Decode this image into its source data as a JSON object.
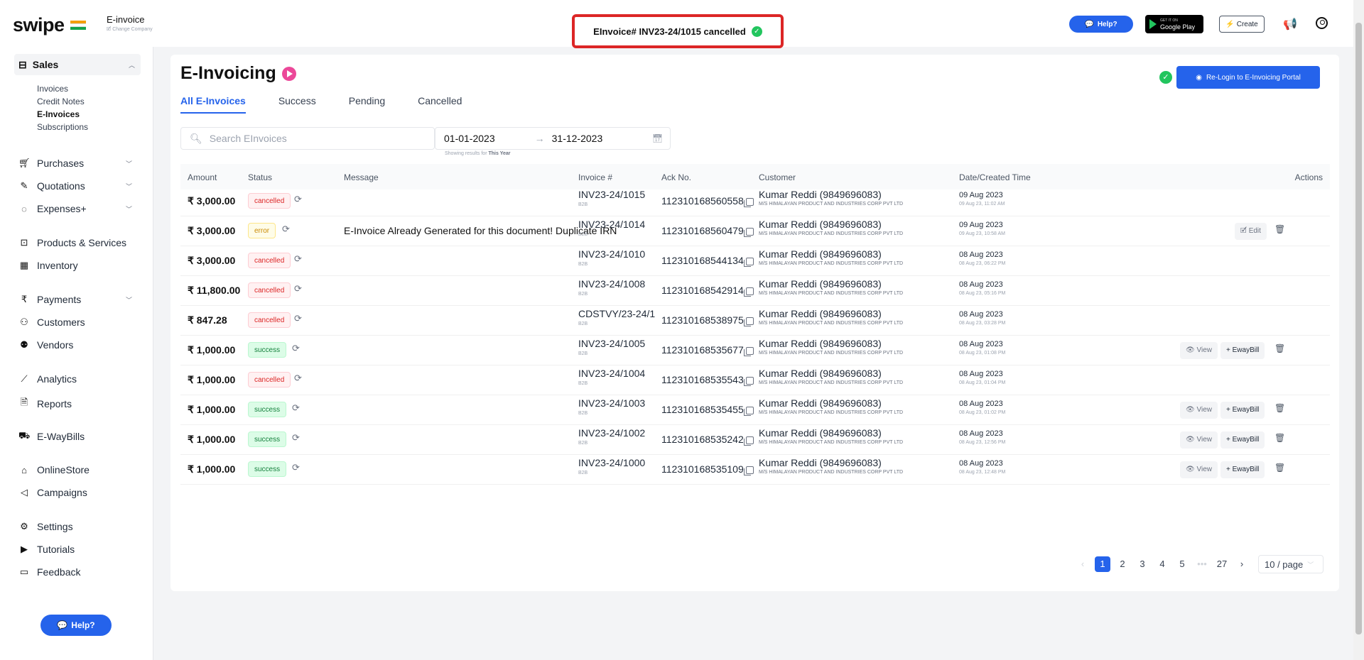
{
  "brand": {
    "name": "swipe"
  },
  "company": {
    "title": "E-invoice",
    "subtitle": "🗹 Change Company"
  },
  "toast": {
    "text": "EInvoice# INV23-24/1015 cancelled"
  },
  "header": {
    "help_label": "Help?",
    "play_small": "GET IT ON",
    "play_label": "Google Play",
    "create_label": "Create"
  },
  "sidebar": {
    "sales_label": "Sales",
    "sub_items": [
      "Invoices",
      "Credit Notes",
      "E-Invoices",
      "Subscriptions"
    ],
    "items": [
      "Purchases",
      "Quotations",
      "Expenses+",
      "Products & Services",
      "Inventory",
      "Payments",
      "Customers",
      "Vendors",
      "Analytics",
      "Reports",
      "E-WayBills",
      "OnlineStore",
      "Campaigns",
      "Settings",
      "Tutorials",
      "Feedback"
    ],
    "help_label": "Help?"
  },
  "page": {
    "title": "E-Invoicing",
    "relogin_label": "Re-Login to E-Invoicing Portal"
  },
  "tabs": [
    "All E-Invoices",
    "Success",
    "Pending",
    "Cancelled"
  ],
  "search": {
    "placeholder": "Search EInvoices"
  },
  "daterange": {
    "from": "01-01-2023",
    "to": "31-12-2023",
    "note_prefix": "Showing results for",
    "note_period": "This Year"
  },
  "table": {
    "headers": {
      "amount": "Amount",
      "status": "Status",
      "message": "Message",
      "invoice": "Invoice #",
      "ack": "Ack No.",
      "customer": "Customer",
      "date": "Date/Created Time",
      "actions": "Actions"
    },
    "rows": [
      {
        "amount": "₹ 3,000.00",
        "status": "cancelled",
        "message": "",
        "invoice": "INV23-24/1015",
        "inv_type": "B2B",
        "ack": "112310168560558",
        "customer": "Kumar Reddi (9849696083)",
        "company": "M/S HIMALAYAN PRODUCT AND INDUSTRIES CORP PVT LTD",
        "date": "09 Aug 2023",
        "time": "09 Aug 23, 11:02 AM",
        "actions": []
      },
      {
        "amount": "₹ 3,000.00",
        "status": "error",
        "message": "E-Invoice Already Generated for this document! Duplicate IRN",
        "invoice": "INV23-24/1014",
        "inv_type": "B2B",
        "ack": "112310168560479",
        "customer": "Kumar Reddi (9849696083)",
        "company": "M/S HIMALAYAN PRODUCT AND INDUSTRIES CORP PVT LTD",
        "date": "09 Aug 2023",
        "time": "09 Aug 23, 10:58 AM",
        "actions": [
          "edit"
        ]
      },
      {
        "amount": "₹ 3,000.00",
        "status": "cancelled",
        "message": "",
        "invoice": "INV23-24/1010",
        "inv_type": "B2B",
        "ack": "112310168544134",
        "customer": "Kumar Reddi (9849696083)",
        "company": "M/S HIMALAYAN PRODUCT AND INDUSTRIES CORP PVT LTD",
        "date": "08 Aug 2023",
        "time": "08 Aug 23, 06:22 PM",
        "actions": []
      },
      {
        "amount": "₹ 11,800.00",
        "status": "cancelled",
        "message": "",
        "invoice": "INV23-24/1008",
        "inv_type": "B2B",
        "ack": "112310168542914",
        "customer": "Kumar Reddi (9849696083)",
        "company": "M/S HIMALAYAN PRODUCT AND INDUSTRIES CORP PVT LTD",
        "date": "08 Aug 2023",
        "time": "08 Aug 23, 05:16 PM",
        "actions": []
      },
      {
        "amount": "₹ 847.28",
        "status": "cancelled",
        "message": "",
        "invoice": "CDSTVY/23-24/1",
        "inv_type": "B2B",
        "ack": "112310168538975",
        "customer": "Kumar Reddi (9849696083)",
        "company": "M/S HIMALAYAN PRODUCT AND INDUSTRIES CORP PVT LTD",
        "date": "08 Aug 2023",
        "time": "08 Aug 23, 03:28 PM",
        "actions": []
      },
      {
        "amount": "₹ 1,000.00",
        "status": "success",
        "message": "",
        "invoice": "INV23-24/1005",
        "inv_type": "B2B",
        "ack": "112310168535677",
        "customer": "Kumar Reddi (9849696083)",
        "company": "M/S HIMALAYAN PRODUCT AND INDUSTRIES CORP PVT LTD",
        "date": "08 Aug 2023",
        "time": "08 Aug 23, 01:08 PM",
        "actions": [
          "view",
          "eway",
          "trash"
        ]
      },
      {
        "amount": "₹ 1,000.00",
        "status": "cancelled",
        "message": "",
        "invoice": "INV23-24/1004",
        "inv_type": "B2B",
        "ack": "112310168535543",
        "customer": "Kumar Reddi (9849696083)",
        "company": "M/S HIMALAYAN PRODUCT AND INDUSTRIES CORP PVT LTD",
        "date": "08 Aug 2023",
        "time": "08 Aug 23, 01:04 PM",
        "actions": []
      },
      {
        "amount": "₹ 1,000.00",
        "status": "success",
        "message": "",
        "invoice": "INV23-24/1003",
        "inv_type": "B2B",
        "ack": "112310168535455",
        "customer": "Kumar Reddi (9849696083)",
        "company": "M/S HIMALAYAN PRODUCT AND INDUSTRIES CORP PVT LTD",
        "date": "08 Aug 2023",
        "time": "08 Aug 23, 01:02 PM",
        "actions": [
          "view",
          "eway",
          "trash"
        ]
      },
      {
        "amount": "₹ 1,000.00",
        "status": "success",
        "message": "",
        "invoice": "INV23-24/1002",
        "inv_type": "B2B",
        "ack": "112310168535242",
        "customer": "Kumar Reddi (9849696083)",
        "company": "M/S HIMALAYAN PRODUCT AND INDUSTRIES CORP PVT LTD",
        "date": "08 Aug 2023",
        "time": "08 Aug 23, 12:56 PM",
        "actions": [
          "view",
          "eway",
          "trash"
        ]
      },
      {
        "amount": "₹ 1,000.00",
        "status": "success",
        "message": "",
        "invoice": "INV23-24/1000",
        "inv_type": "B2B",
        "ack": "112310168535109",
        "customer": "Kumar Reddi (9849696083)",
        "company": "M/S HIMALAYAN PRODUCT AND INDUSTRIES CORP PVT LTD",
        "date": "08 Aug 2023",
        "time": "08 Aug 23, 12:48 PM",
        "actions": [
          "view",
          "eway",
          "trash"
        ]
      }
    ],
    "action_labels": {
      "edit": "Edit",
      "view": "View",
      "eway": "+ EwayBill"
    }
  },
  "pagination": {
    "pages": [
      "1",
      "2",
      "3",
      "4",
      "5",
      "•••",
      "27"
    ],
    "current": "1",
    "page_size": "10 / page"
  },
  "colors": {
    "accent": "#2563eb",
    "success": "#22c55e",
    "danger": "#dc2626",
    "toast_border": "#dc2626"
  }
}
